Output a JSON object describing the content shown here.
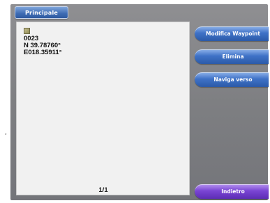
{
  "header": {
    "tab_label": "Principale"
  },
  "waypoint": {
    "name": "0023",
    "latitude": "N  39.78760°",
    "longitude": "E018.35911°"
  },
  "pager": {
    "label": "1/1"
  },
  "actions": {
    "modify": "Modifica Waypoint",
    "delete": "Elimina",
    "navigate": "Naviga verso",
    "back": "Indietro"
  },
  "margin_mark": ",",
  "colors": {
    "action_blue": "#3f72c7",
    "back_purple": "#7a45d4",
    "panel_bg": "#f1f1f1",
    "device_gray": "#7e7f82"
  },
  "icons": {
    "waypoint": "waypoint-flag-icon"
  }
}
